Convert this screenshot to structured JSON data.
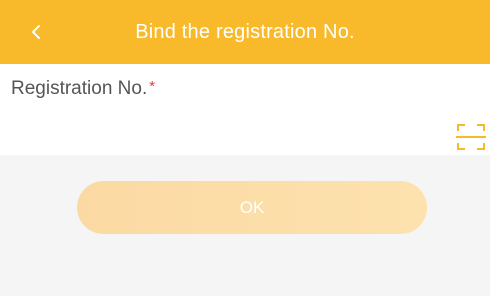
{
  "header": {
    "title": "Bind the registration No.",
    "back_icon": "chevron-left-icon",
    "background_color": "#f8b92b"
  },
  "form": {
    "field_label": "Registration No.",
    "required_marker": "*",
    "input_value": "",
    "input_placeholder": "",
    "scan_icon": "scan-icon"
  },
  "actions": {
    "ok_label": "OK",
    "ok_state": "disabled"
  }
}
